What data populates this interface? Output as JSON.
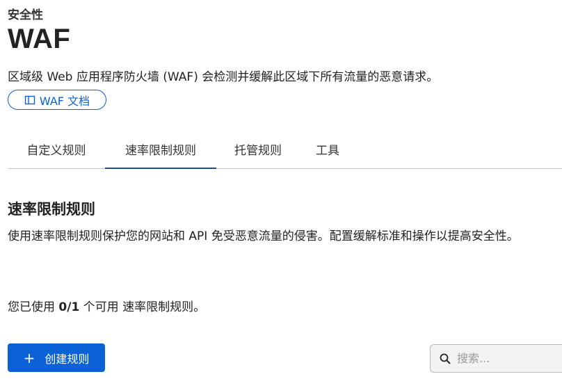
{
  "header": {
    "breadcrumb": "安全性",
    "title": "WAF",
    "description": "区域级 Web 应用程序防火墙 (WAF) 会检测并缓解此区域下所有流量的恶意请求。",
    "doc_link_label": "WAF 文档",
    "doc_link_icon": "book-icon"
  },
  "tabs": [
    {
      "label": "自定义规则",
      "active": false
    },
    {
      "label": "速率限制规则",
      "active": true
    },
    {
      "label": "托管规则",
      "active": false
    },
    {
      "label": "工具",
      "active": false
    }
  ],
  "section": {
    "title": "速率限制规则",
    "description": "使用速率限制规则保护您的网站和 API 免受恶意流量的侵害。配置缓解标准和操作以提高安全性。",
    "usage_prefix": "您已使用 ",
    "usage_count": "0/1",
    "usage_suffix": " 个可用 速率限制规则。"
  },
  "actions": {
    "create_label": "创建规则",
    "create_icon": "plus-icon",
    "search_placeholder": "搜索...",
    "search_value": "",
    "search_icon": "search-icon"
  },
  "colors": {
    "accent": "#0b62d6",
    "tab_underline": "#1b4e8f"
  }
}
